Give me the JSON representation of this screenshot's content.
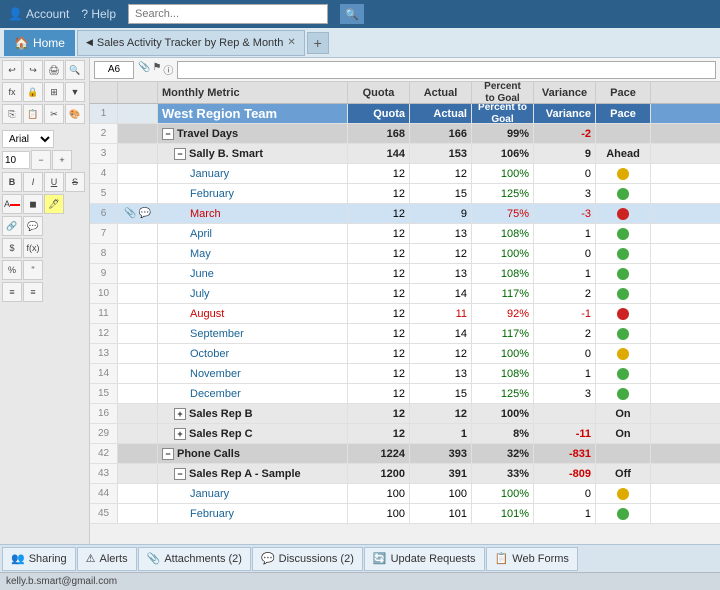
{
  "topnav": {
    "account_label": "Account",
    "help_label": "? Help",
    "search_placeholder": "Search..."
  },
  "tabs": {
    "home_label": "Home",
    "sheet_label": "Sales Activity Tracker by Rep & Month"
  },
  "toolbar": {
    "font": "Arial",
    "fontsize": "10"
  },
  "grid": {
    "columns": [
      "Monthly Metric",
      "Quota",
      "Actual",
      "Percent to Goal",
      "Variance",
      "Pace"
    ],
    "col_header_sub": [
      "Quota",
      "Actual",
      "Percent to Goal",
      "Variance",
      "Pace"
    ]
  },
  "rows": [
    {
      "num": "1",
      "type": "region_header",
      "indent": 0,
      "label": "West Region Team",
      "quota": "Quota",
      "actual": "Actual",
      "percent": "Percent to Goal",
      "variance": "Variance",
      "pace": "Pace",
      "icon": null
    },
    {
      "num": "2",
      "type": "group",
      "indent": 0,
      "label": "Travel Days",
      "quota": "168",
      "actual": "166",
      "percent": "99%",
      "variance": "-2",
      "pace": "",
      "icon": null,
      "expand": "minus"
    },
    {
      "num": "3",
      "type": "subgroup",
      "indent": 1,
      "label": "Sally B. Smart",
      "quota": "144",
      "actual": "153",
      "percent": "106%",
      "variance": "9",
      "pace": "Ahead",
      "expand": "minus"
    },
    {
      "num": "4",
      "type": "data",
      "indent": 2,
      "label": "January",
      "quota": "12",
      "actual": "12",
      "percent": "100%",
      "variance": "0",
      "pace": "dot-yellow",
      "monthcolor": "blue"
    },
    {
      "num": "5",
      "type": "data",
      "indent": 2,
      "label": "February",
      "quota": "12",
      "actual": "15",
      "percent": "125%",
      "variance": "3",
      "pace": "dot-green",
      "monthcolor": "blue"
    },
    {
      "num": "6",
      "type": "data",
      "indent": 2,
      "label": "March",
      "quota": "12",
      "actual": "9",
      "percent": "75%",
      "variance": "-3",
      "pace": "dot-red",
      "monthcolor": "red"
    },
    {
      "num": "7",
      "type": "data",
      "indent": 2,
      "label": "April",
      "quota": "12",
      "actual": "13",
      "percent": "108%",
      "variance": "1",
      "pace": "dot-green",
      "monthcolor": "blue"
    },
    {
      "num": "8",
      "type": "data",
      "indent": 2,
      "label": "May",
      "quota": "12",
      "actual": "12",
      "percent": "100%",
      "variance": "0",
      "pace": "dot-green",
      "monthcolor": "blue"
    },
    {
      "num": "9",
      "type": "data",
      "indent": 2,
      "label": "June",
      "quota": "12",
      "actual": "13",
      "percent": "108%",
      "variance": "1",
      "pace": "dot-green",
      "monthcolor": "blue"
    },
    {
      "num": "10",
      "type": "data",
      "indent": 2,
      "label": "July",
      "quota": "12",
      "actual": "14",
      "percent": "117%",
      "variance": "2",
      "pace": "dot-green",
      "monthcolor": "blue"
    },
    {
      "num": "11",
      "type": "data",
      "indent": 2,
      "label": "August",
      "quota": "12",
      "actual": "11",
      "percent": "92%",
      "variance": "-1",
      "pace": "dot-red",
      "monthcolor": "red"
    },
    {
      "num": "12",
      "type": "data",
      "indent": 2,
      "label": "September",
      "quota": "12",
      "actual": "14",
      "percent": "117%",
      "variance": "2",
      "pace": "dot-green",
      "monthcolor": "blue"
    },
    {
      "num": "13",
      "type": "data",
      "indent": 2,
      "label": "October",
      "quota": "12",
      "actual": "12",
      "percent": "100%",
      "variance": "0",
      "pace": "dot-yellow",
      "monthcolor": "blue"
    },
    {
      "num": "14",
      "type": "data",
      "indent": 2,
      "label": "November",
      "quota": "12",
      "actual": "13",
      "percent": "108%",
      "variance": "1",
      "pace": "dot-green",
      "monthcolor": "blue"
    },
    {
      "num": "15",
      "type": "data",
      "indent": 2,
      "label": "December",
      "quota": "12",
      "actual": "15",
      "percent": "125%",
      "variance": "3",
      "pace": "dot-green",
      "monthcolor": "blue"
    },
    {
      "num": "16",
      "type": "subgroup",
      "indent": 1,
      "label": "Sales Rep B",
      "quota": "12",
      "actual": "12",
      "percent": "100%",
      "variance": "",
      "pace": "On",
      "expand": "plus"
    },
    {
      "num": "29",
      "type": "subgroup",
      "indent": 1,
      "label": "Sales Rep C",
      "quota": "12",
      "actual": "1",
      "percent": "8%",
      "variance": "-11",
      "pace": "On",
      "expand": "plus"
    },
    {
      "num": "42",
      "type": "group",
      "indent": 0,
      "label": "Phone Calls",
      "quota": "1224",
      "actual": "393",
      "percent": "32%",
      "variance": "-831",
      "pace": "",
      "expand": "minus"
    },
    {
      "num": "43",
      "type": "subgroup",
      "indent": 1,
      "label": "Sales Rep A - Sample",
      "quota": "1200",
      "actual": "391",
      "percent": "33%",
      "variance": "-809",
      "pace": "Off",
      "expand": "minus"
    },
    {
      "num": "44",
      "type": "data",
      "indent": 2,
      "label": "January",
      "quota": "100",
      "actual": "100",
      "percent": "100%",
      "variance": "0",
      "pace": "dot-yellow",
      "monthcolor": "blue"
    },
    {
      "num": "45",
      "type": "data",
      "indent": 2,
      "label": "February",
      "quota": "100",
      "actual": "101",
      "percent": "101%",
      "variance": "1",
      "pace": "dot-green",
      "monthcolor": "blue"
    }
  ],
  "bottom_tabs": [
    {
      "label": "Sharing",
      "icon": "👥"
    },
    {
      "label": "Alerts",
      "icon": "⚠"
    },
    {
      "label": "Attachments (2)",
      "icon": "📎"
    },
    {
      "label": "Discussions (2)",
      "icon": "💬"
    },
    {
      "label": "Update Requests",
      "icon": "🔄"
    },
    {
      "label": "Web Forms",
      "icon": "📋"
    }
  ],
  "status_bar": {
    "user": "kelly.b.smart@gmail.com"
  }
}
